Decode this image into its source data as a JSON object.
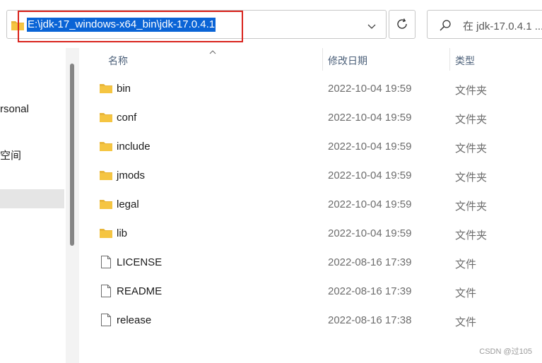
{
  "address_bar": {
    "path": "E:\\jdk-17_windows-x64_bin\\jdk-17.0.4.1"
  },
  "search": {
    "placeholder": "在 jdk-17.0.4.1 ..."
  },
  "nav_pane": {
    "items": [
      {
        "label": "rsonal"
      },
      {
        "label": "空间"
      }
    ]
  },
  "columns": {
    "name": "名称",
    "date": "修改日期",
    "type": "类型"
  },
  "files": [
    {
      "name": "bin",
      "date": "2022-10-04 19:59",
      "type": "文件夹",
      "icon": "folder-icon"
    },
    {
      "name": "conf",
      "date": "2022-10-04 19:59",
      "type": "文件夹",
      "icon": "folder-icon"
    },
    {
      "name": "include",
      "date": "2022-10-04 19:59",
      "type": "文件夹",
      "icon": "folder-icon"
    },
    {
      "name": "jmods",
      "date": "2022-10-04 19:59",
      "type": "文件夹",
      "icon": "folder-icon"
    },
    {
      "name": "legal",
      "date": "2022-10-04 19:59",
      "type": "文件夹",
      "icon": "folder-icon"
    },
    {
      "name": "lib",
      "date": "2022-10-04 19:59",
      "type": "文件夹",
      "icon": "folder-icon"
    },
    {
      "name": "LICENSE",
      "date": "2022-08-16 17:39",
      "type": "文件",
      "icon": "file-icon"
    },
    {
      "name": "README",
      "date": "2022-08-16 17:39",
      "type": "文件",
      "icon": "file-icon"
    },
    {
      "name": "release",
      "date": "2022-08-16 17:38",
      "type": "文件",
      "icon": "file-icon"
    }
  ],
  "watermark": "CSDN @过105",
  "colors": {
    "selection": "#0a64d6",
    "highlight_box": "#d9231d",
    "folder": "#f5c542"
  }
}
